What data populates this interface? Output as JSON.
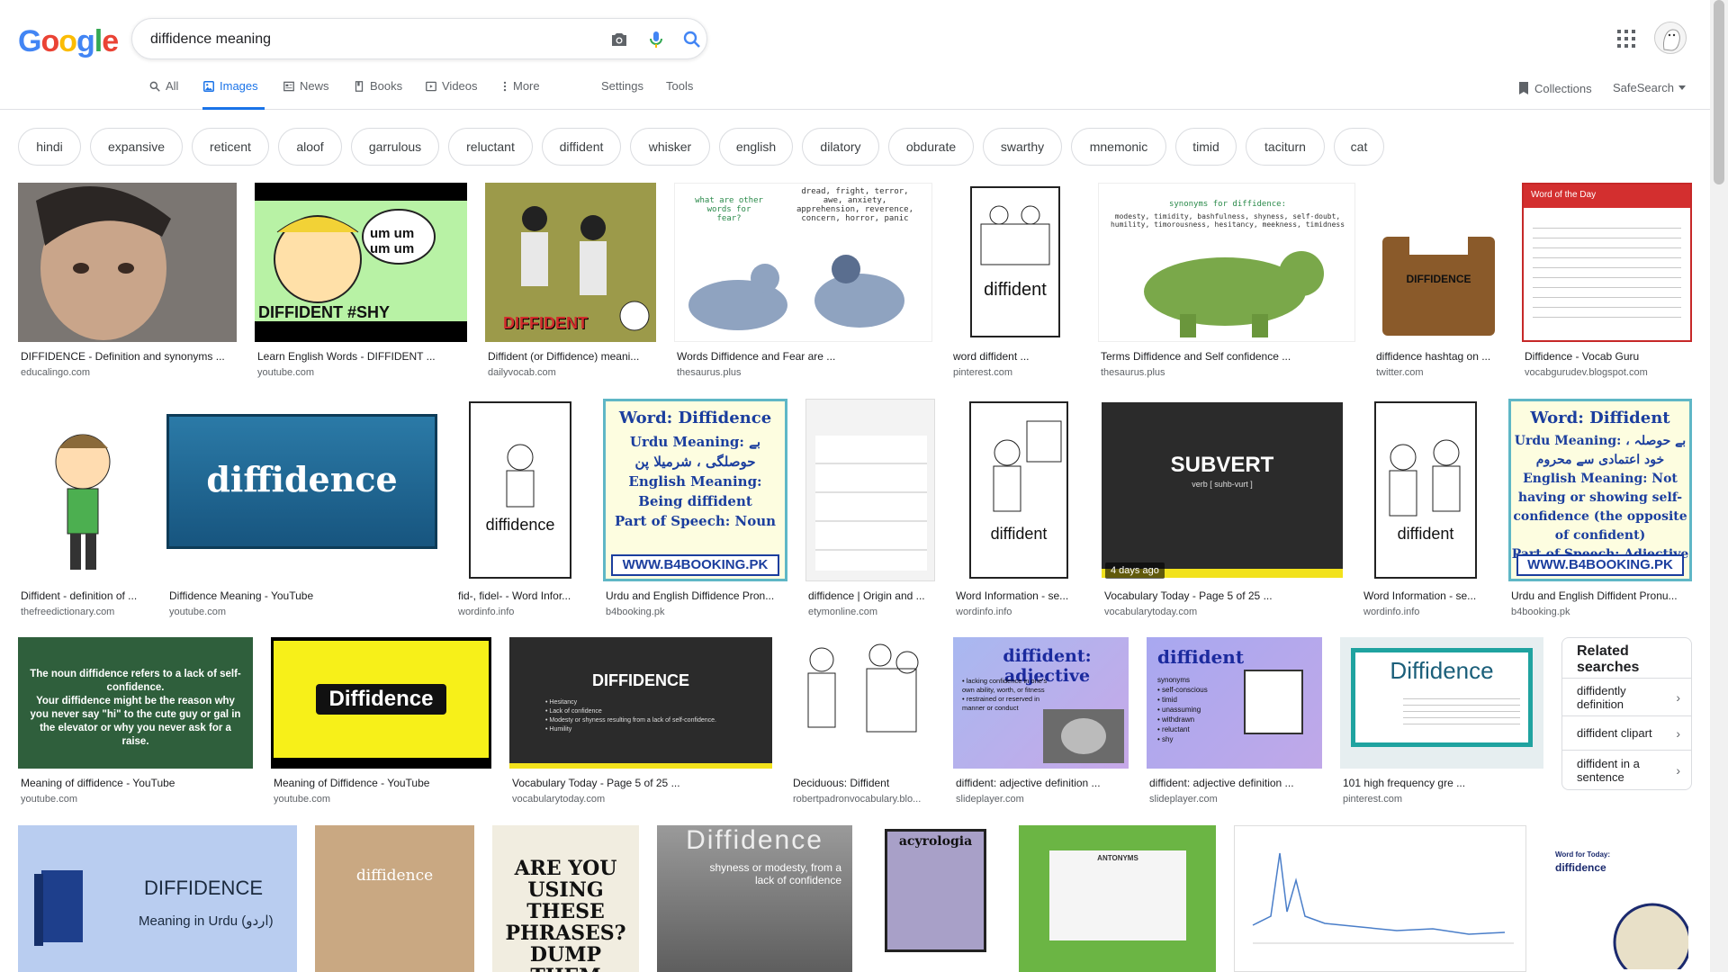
{
  "logo": "Google",
  "search": {
    "query": "diffidence meaning"
  },
  "tabs": [
    {
      "label": "All"
    },
    {
      "label": "Images"
    },
    {
      "label": "News"
    },
    {
      "label": "Books"
    },
    {
      "label": "Videos"
    },
    {
      "label": "More"
    }
  ],
  "tools": {
    "settings": "Settings",
    "tools": "Tools",
    "collections": "Collections",
    "safesearch": "SafeSearch"
  },
  "chips": [
    "hindi",
    "expansive",
    "reticent",
    "aloof",
    "garrulous",
    "reluctant",
    "diffident",
    "whisker",
    "english",
    "dilatory",
    "obdurate",
    "swarthy",
    "mnemonic",
    "timid",
    "taciturn",
    "cat"
  ],
  "rows": [
    [
      {
        "title": "DIFFIDENCE - Definition and synonyms ...",
        "source": "educalingo.com",
        "thumb_text": "",
        "bg": "#6f6a66"
      },
      {
        "title": "Learn English Words - DIFFIDENT ...",
        "source": "youtube.com",
        "thumb_text": "DIFFIDENT  #SHY",
        "bg": "#b8f2a5"
      },
      {
        "title": "Diffident (or Diffidence) meani...",
        "source": "dailyvocab.com",
        "thumb_text": "DIFFIDENT",
        "bg": "#8a8a3c"
      },
      {
        "title": "Words Diffidence and Fear are ...",
        "source": "thesaurus.plus",
        "thumb_text": "what are other words for fear?",
        "bg": "#ffffff"
      },
      {
        "title": "word diffident ...",
        "source": "pinterest.com",
        "thumb_text": "diffident",
        "bg": "#ffffff"
      },
      {
        "title": "Terms Diffidence and Self confidence ...",
        "source": "thesaurus.plus",
        "thumb_text": "synonyms for diffidence:",
        "bg": "#ffffff"
      },
      {
        "title": "diffidence hashtag on ...",
        "source": "twitter.com",
        "thumb_text": "DIFFIDENCE",
        "bg": "#ffffff"
      },
      {
        "title": "Diffidence - Vocab Guru",
        "source": "vocabgurudev.blogspot.com",
        "thumb_text": "Word of the Day",
        "bg": "#ffffff"
      }
    ],
    [
      {
        "title": "Diffident - definition of ...",
        "source": "thefreedictionary.com",
        "thumb_text": "",
        "bg": "#ffffff"
      },
      {
        "title": "Diffidence Meaning - YouTube",
        "source": "youtube.com",
        "thumb_text": "diffidence",
        "bg": "#1f5f86"
      },
      {
        "title": "fid-, fidel- - Word Infor...",
        "source": "wordinfo.info",
        "thumb_text": "diffidence",
        "bg": "#ffffff"
      },
      {
        "title": "Urdu and English Diffidence Pron...",
        "source": "b4booking.pk",
        "thumb_text": "Word: Diffidence",
        "bg": "#fdfde0"
      },
      {
        "title": "diffidence | Origin and ...",
        "source": "etymonline.com",
        "thumb_text": "",
        "bg": "#f3f3f3"
      },
      {
        "title": "Word Information - se...",
        "source": "wordinfo.info",
        "thumb_text": "diffident",
        "bg": "#ffffff"
      },
      {
        "title": "Vocabulary Today - Page 5 of 25 ...",
        "source": "vocabularytoday.com",
        "thumb_text": "SUBVERT",
        "bg": "#2b2b2b",
        "badge": "4 days ago"
      },
      {
        "title": "Word Information - se...",
        "source": "wordinfo.info",
        "thumb_text": "diffident",
        "bg": "#ffffff"
      },
      {
        "title": "Urdu and English Diffident Pronu...",
        "source": "b4booking.pk",
        "thumb_text": "Word: Diffident",
        "bg": "#fdfde0"
      }
    ],
    [
      {
        "title": "Meaning of diffidence - YouTube",
        "source": "youtube.com",
        "thumb_text": "The noun diffidence refers to a lack of self-confidence.",
        "bg": "#2f5f3c"
      },
      {
        "title": "Meaning of Diffidence - YouTube",
        "source": "youtube.com",
        "thumb_text": "Diffidence",
        "bg": "#f7f019"
      },
      {
        "title": "Vocabulary Today - Page 5 of 25 ...",
        "source": "vocabularytoday.com",
        "thumb_text": "DIFFIDENCE",
        "bg": "#2b2b2b"
      },
      {
        "title": "Deciduous: Diffident",
        "source": "robertpadronvocabulary.blo...",
        "thumb_text": "",
        "bg": "#ffffff"
      },
      {
        "title": "diffident: adjective definition ...",
        "source": "slideplayer.com",
        "thumb_text": "diffident: adjective",
        "bg": "#b9a7ea"
      },
      {
        "title": "diffident: adjective definition ...",
        "source": "slideplayer.com",
        "thumb_text": "diffident",
        "bg": "#b39ee8"
      },
      {
        "title": "101 high frequency gre ...",
        "source": "pinterest.com",
        "thumb_text": "Diffidence",
        "bg": "#e6eef0"
      }
    ],
    [
      {
        "title": "",
        "source": "",
        "thumb_text": "DIFFIDENCE",
        "bg": "#b9cdf0",
        "subtext": "Meaning in Urdu (اردو)"
      },
      {
        "title": "",
        "source": "",
        "thumb_text": "diffidence",
        "bg": "#c9a882"
      },
      {
        "title": "",
        "source": "",
        "thumb_text": "ARE YOU USING THESE PHRASES? DUMP THEM NOW!",
        "bg": "#f1ede0"
      },
      {
        "title": "",
        "source": "",
        "thumb_text": "Diffidence",
        "bg": "#7e7e7e",
        "subtext": "shyness or modesty, from a lack of confidence"
      },
      {
        "title": "",
        "source": "",
        "thumb_text": "acyrologia",
        "bg": "#ffffff"
      },
      {
        "title": "",
        "source": "",
        "thumb_text": "ANTONYMS",
        "bg": "#6bb544"
      },
      {
        "title": "",
        "source": "",
        "thumb_text": "",
        "bg": "#ffffff"
      },
      {
        "title": "",
        "source": "",
        "thumb_text": "diffidence",
        "bg": "#ffffff",
        "subtext": "Word for Today:"
      }
    ]
  ],
  "related": {
    "title": "Related searches",
    "items": [
      "diffidently definition",
      "diffident clipart",
      "diffident in a sentence"
    ]
  },
  "colors": {
    "accent": "#1a73e8",
    "text": "#202124",
    "muted": "#5f6368",
    "border": "#dadce0"
  }
}
